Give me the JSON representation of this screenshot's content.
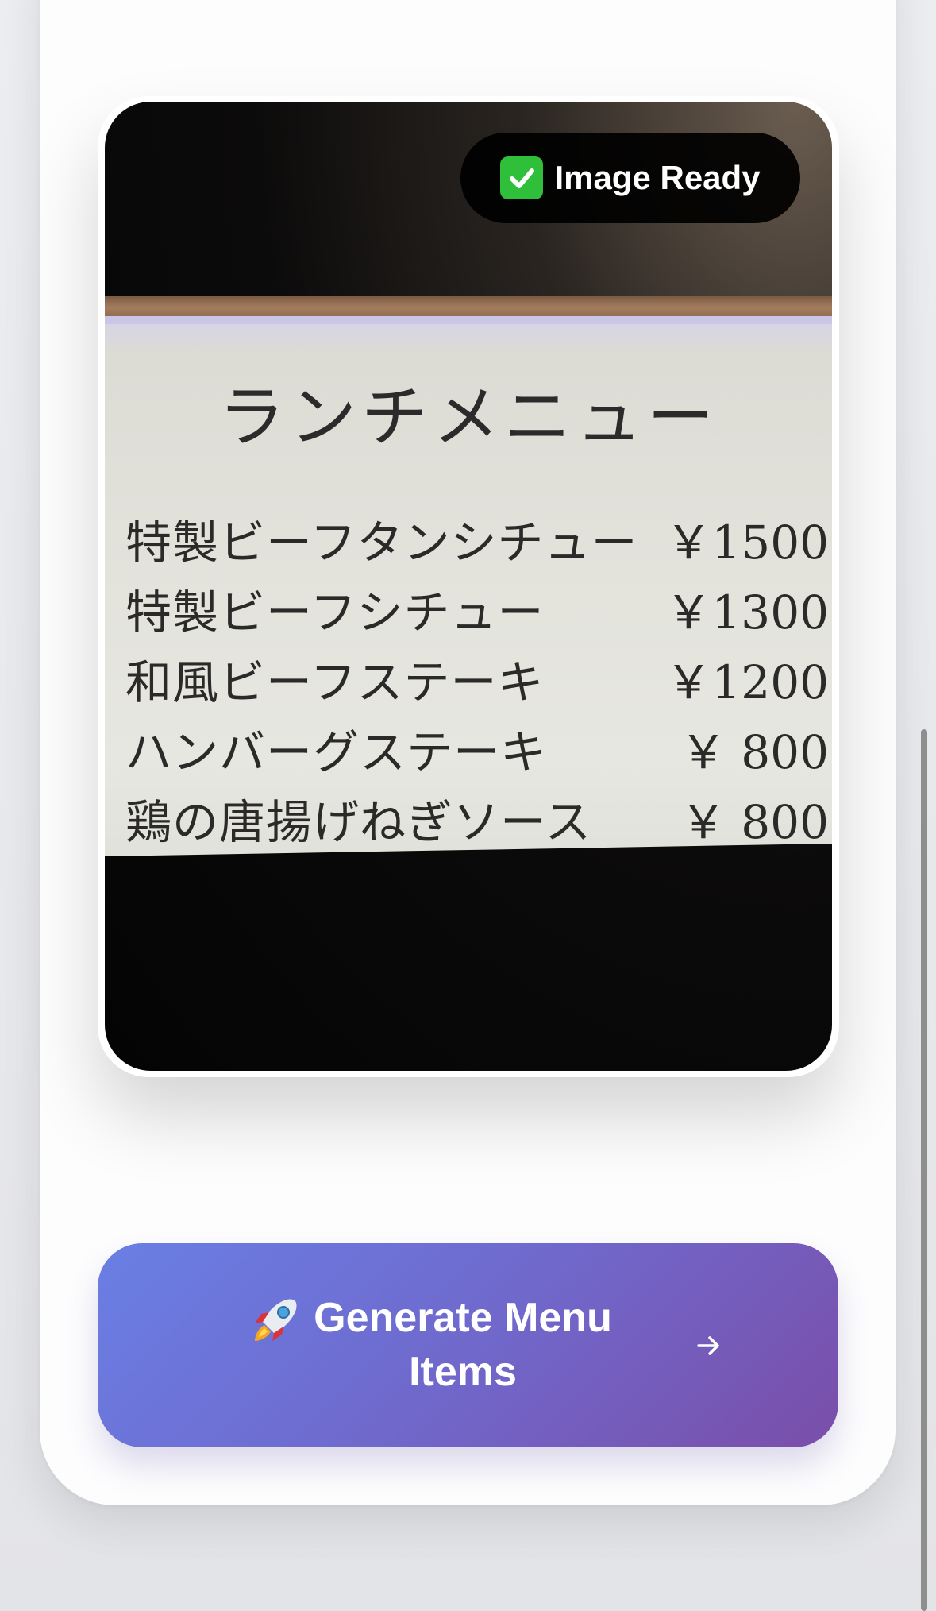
{
  "badge": {
    "icon": "check-icon",
    "label": "Image Ready"
  },
  "photo": {
    "menu_title": "ランチメニュー",
    "items": [
      {
        "name": "特製ビーフタンシチュー",
        "price": "￥1500"
      },
      {
        "name": "特製ビーフシチュー",
        "price": "￥1300"
      },
      {
        "name": "和風ビーフステーキ",
        "price": "￥1200"
      },
      {
        "name": "ハンバーグステーキ",
        "price": "￥ 800"
      },
      {
        "name": "鶏の唐揚げねぎソース",
        "price": "￥ 800"
      }
    ]
  },
  "cta": {
    "icon": "rocket-icon",
    "label": "Generate Menu Items",
    "trailing_icon": "arrow-right-icon"
  },
  "colors": {
    "cta_gradient_start": "#6a7fe4",
    "cta_gradient_end": "#7a4ea9",
    "badge_bg": "#000000",
    "check_green": "#2fbf3a"
  }
}
